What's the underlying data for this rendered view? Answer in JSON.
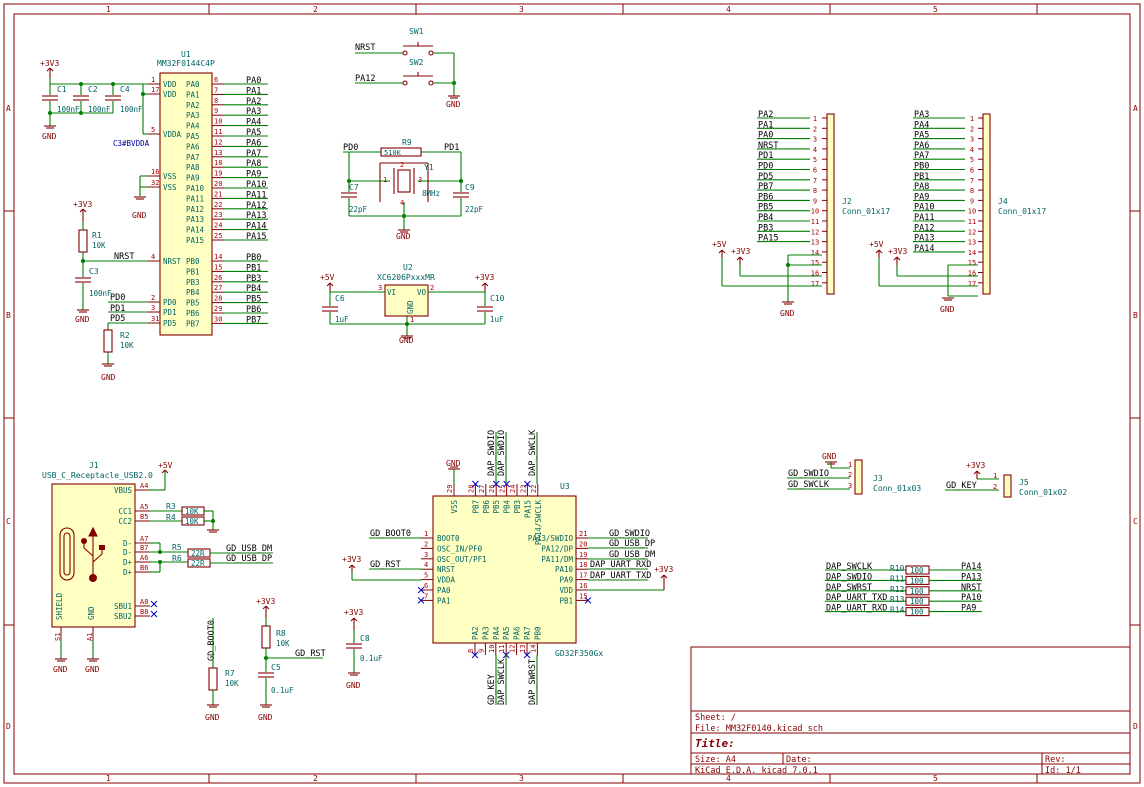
{
  "border": {
    "columns": [
      "1",
      "2",
      "3",
      "4",
      "5"
    ],
    "rows": [
      "A",
      "B",
      "C",
      "D"
    ]
  },
  "title_block": {
    "sheet": "Sheet: /",
    "file": "File: MM32F0140.kicad_sch",
    "title_label": "Title:",
    "size": "Size: A4",
    "date": "Date:",
    "rev": "Rev:",
    "tool": "KiCad E.D.A.  kicad 7.0.1",
    "id": "Id: 1/1"
  },
  "u1": {
    "ref": "U1",
    "value": "MM32F0144C4P",
    "left_pins": [
      {
        "name": "VDD",
        "num": "1"
      },
      {
        "name": "VDD",
        "num": "17"
      },
      {
        "name": "VDDA",
        "num": "5"
      },
      {
        "name": "VSS",
        "num": "16"
      },
      {
        "name": "VSS",
        "num": "32"
      },
      {
        "name": "NRST",
        "num": "4"
      },
      {
        "name": "PD0",
        "num": "2"
      },
      {
        "name": "PD1",
        "num": "3"
      },
      {
        "name": "PD5",
        "num": "31"
      }
    ],
    "right_pins": [
      {
        "name": "PA0",
        "num": "6"
      },
      {
        "name": "PA1",
        "num": "7"
      },
      {
        "name": "PA2",
        "num": "8"
      },
      {
        "name": "PA3",
        "num": "9"
      },
      {
        "name": "PA4",
        "num": "10"
      },
      {
        "name": "PA5",
        "num": "11"
      },
      {
        "name": "PA6",
        "num": "12"
      },
      {
        "name": "PA7",
        "num": "13"
      },
      {
        "name": "PA8",
        "num": "18"
      },
      {
        "name": "PA9",
        "num": "19"
      },
      {
        "name": "PA10",
        "num": "20"
      },
      {
        "name": "PA11",
        "num": "21"
      },
      {
        "name": "PA12",
        "num": "22"
      },
      {
        "name": "PA13",
        "num": "23"
      },
      {
        "name": "PA14",
        "num": "24"
      },
      {
        "name": "PA15",
        "num": "25"
      },
      {
        "name": "PB0",
        "num": "14"
      },
      {
        "name": "PB1",
        "num": "15"
      },
      {
        "name": "PB3",
        "num": "26"
      },
      {
        "name": "PB4",
        "num": "27"
      },
      {
        "name": "PB5",
        "num": "28"
      },
      {
        "name": "PB6",
        "num": "29"
      },
      {
        "name": "PB7",
        "num": "30"
      }
    ],
    "right_labels": [
      "PA0",
      "PA1",
      "PA2",
      "PA3",
      "PA4",
      "PA5",
      "PA6",
      "PA7",
      "PA8",
      "PA9",
      "PA10",
      "PA11",
      "PA12",
      "PA13",
      "PA14",
      "PA15",
      "PB0",
      "PB1",
      "PB3",
      "PB4",
      "PB5",
      "PB6",
      "PB7"
    ],
    "left_labels": {
      "nrst": "NRST",
      "pd0": "PD0",
      "pd1": "PD1",
      "pd5": "PD5"
    },
    "overlap_text": "C3#BVDDA"
  },
  "caps_top": {
    "c1": "C1",
    "c1v": "100nF",
    "c2": "C2",
    "c2v": "100nF",
    "c4": "C4",
    "c4v": "100nF"
  },
  "r1": {
    "ref": "R1",
    "val": "10K"
  },
  "c3": {
    "ref": "C3",
    "val": "100nF"
  },
  "r2": {
    "ref": "R2",
    "val": "10K"
  },
  "power": {
    "v33": "+3V3",
    "v5": "+5V",
    "gnd": "GND"
  },
  "sw": {
    "sw1": "SW1",
    "sw2": "SW2",
    "nrst": "NRST",
    "pa12": "PA12"
  },
  "crystal": {
    "r9": "R9",
    "r9v": "510K",
    "y1": "Y1",
    "y1v": "8MHz",
    "c7": "C7",
    "c7v": "22pF",
    "c9": "C9",
    "c9v": "22pF",
    "pd0": "PD0",
    "pd1": "PD1",
    "p1": "1",
    "p2": "2",
    "p3": "3",
    "p4": "4"
  },
  "u2": {
    "ref": "U2",
    "val": "XC6206PxxxMR",
    "vi": "VI",
    "vo": "VO",
    "gnd": "GND",
    "p3": "3",
    "p2": "2",
    "p1": "1",
    "c6": "C6",
    "c6v": "1uF",
    "c10": "C10",
    "c10v": "1uF"
  },
  "j2": {
    "ref": "J2",
    "val": "Conn_01x17",
    "labels": [
      "PA2",
      "PA1",
      "PA0",
      "NRST",
      "PD1",
      "PD0",
      "PD5",
      "PB7",
      "PB6",
      "PB5",
      "PB4",
      "PB3",
      "PA15"
    ],
    "nums": [
      "1",
      "2",
      "3",
      "4",
      "5",
      "6",
      "7",
      "8",
      "9",
      "10",
      "11",
      "12",
      "13",
      "14",
      "15",
      "16",
      "17"
    ]
  },
  "j4": {
    "ref": "J4",
    "val": "Conn_01x17",
    "labels": [
      "PA3",
      "PA4",
      "PA5",
      "PA6",
      "PA7",
      "PB0",
      "PB1",
      "PA8",
      "PA9",
      "PA10",
      "PA11",
      "PA12",
      "PA13",
      "PA14"
    ],
    "nums": [
      "1",
      "2",
      "3",
      "4",
      "5",
      "6",
      "7",
      "8",
      "9",
      "10",
      "11",
      "12",
      "13",
      "14",
      "15",
      "16",
      "17"
    ]
  },
  "j3": {
    "ref": "J3",
    "val": "Conn_01x03",
    "labels": [
      "GD_SWDIO",
      "GD_SWCLK"
    ],
    "nums": [
      "1",
      "2",
      "3"
    ]
  },
  "j5": {
    "ref": "J5",
    "val": "Conn_01x02",
    "labels": [
      "GD_KEY"
    ],
    "nums": [
      "1",
      "2"
    ]
  },
  "j1": {
    "ref": "J1",
    "val": "USB_C_Receptacle_USB2.0",
    "pins": [
      {
        "name": "VBUS",
        "num": "A4"
      },
      {
        "name": "CC1",
        "num": "A5"
      },
      {
        "name": "CC2",
        "num": "B5"
      },
      {
        "name": "D-",
        "num": "A7"
      },
      {
        "name": "D-",
        "num": "B7"
      },
      {
        "name": "D+",
        "num": "A6"
      },
      {
        "name": "D+",
        "num": "B6"
      },
      {
        "name": "SBU1",
        "num": "A8"
      },
      {
        "name": "SBU2",
        "num": "B8"
      }
    ],
    "shield": "SHIELD",
    "gnd": "GND",
    "s1": "S1",
    "a1": "A1"
  },
  "usb_res": {
    "r3": "R3",
    "r4": "R4",
    "r5": "R5",
    "r6": "R6",
    "r3v": "10K",
    "r4v": "10K",
    "r5v": "22R",
    "r6v": "22R",
    "dm": "GD_USB_DM",
    "dp": "GD_USB_DP"
  },
  "boot": {
    "net": "GD_BOOT0",
    "r7": "R7",
    "r7v": "10K"
  },
  "reset": {
    "r8": "R8",
    "r8v": "10K",
    "c5": "C5",
    "c5v": "0.1uF",
    "net": "GD_RST"
  },
  "c8": {
    "ref": "C8",
    "val": "0.1uF"
  },
  "u3": {
    "ref": "U3",
    "val": "GD32F350Gx",
    "left": [
      {
        "name": "BOOT0",
        "num": "1"
      },
      {
        "name": "OSC_IN/PF0",
        "num": "2"
      },
      {
        "name": "OSC_OUT/PF1",
        "num": "3"
      },
      {
        "name": "NRST",
        "num": "4"
      },
      {
        "name": "VDDA",
        "num": "5"
      },
      {
        "name": "PA0",
        "num": "6"
      },
      {
        "name": "PA1",
        "num": "7"
      }
    ],
    "right": [
      {
        "name": "PA13/SWDIO",
        "num": "21"
      },
      {
        "name": "PA12/DP",
        "num": "20"
      },
      {
        "name": "PA11/DM",
        "num": "19"
      },
      {
        "name": "PA10",
        "num": "18"
      },
      {
        "name": "PA9",
        "num": "17"
      },
      {
        "name": "VDD",
        "num": "16"
      },
      {
        "name": "PB1",
        "num": "15"
      }
    ],
    "top": [
      {
        "name": "VSS",
        "num": "29"
      },
      {
        "name": "PB7",
        "num": "28"
      },
      {
        "name": "PB6",
        "num": "27"
      },
      {
        "name": "PB5",
        "num": "26"
      },
      {
        "name": "PB4",
        "num": "25"
      },
      {
        "name": "PB3",
        "num": "24"
      },
      {
        "name": "PA15",
        "num": "23"
      },
      {
        "name": "PA14/SWCLK",
        "num": "22"
      }
    ],
    "bottom": [
      {
        "name": "PA2",
        "num": "8"
      },
      {
        "name": "PA3",
        "num": "9"
      },
      {
        "name": "PA4",
        "num": "10"
      },
      {
        "name": "PA5",
        "num": "11"
      },
      {
        "name": "PA6",
        "num": "12"
      },
      {
        "name": "PA7",
        "num": "13"
      },
      {
        "name": "PB0",
        "num": "14"
      }
    ],
    "left_labels": {
      "boot": "GD_BOOT0",
      "rst": "GD_RST"
    },
    "right_labels": [
      "GD_SWDIO",
      "GD_USB_DP",
      "GD_USB_DM",
      "DAP_UART_RXD",
      "DAP_UART_TXD"
    ],
    "top_labels": [
      "DAP_SWDIO",
      "DAP_SWDIO",
      "DAP_SWCLK"
    ],
    "bottom_labels": [
      "GD_KEY",
      "DAP_SWCLK",
      "DAP_SWRST"
    ]
  },
  "dap": {
    "rows": [
      {
        "net": "DAP_SWCLK",
        "ref": "R10",
        "val": "100",
        "out": "PA14"
      },
      {
        "net": "DAP_SWDIO",
        "ref": "R11",
        "val": "100",
        "out": "PA13"
      },
      {
        "net": "DAP_SWRST",
        "ref": "R12",
        "val": "100",
        "out": "NRST"
      },
      {
        "net": "DAP_UART_TXD",
        "ref": "R13",
        "val": "100",
        "out": "PA10"
      },
      {
        "net": "DAP_UART_RXD",
        "ref": "R14",
        "val": "100",
        "out": "PA9"
      }
    ]
  }
}
